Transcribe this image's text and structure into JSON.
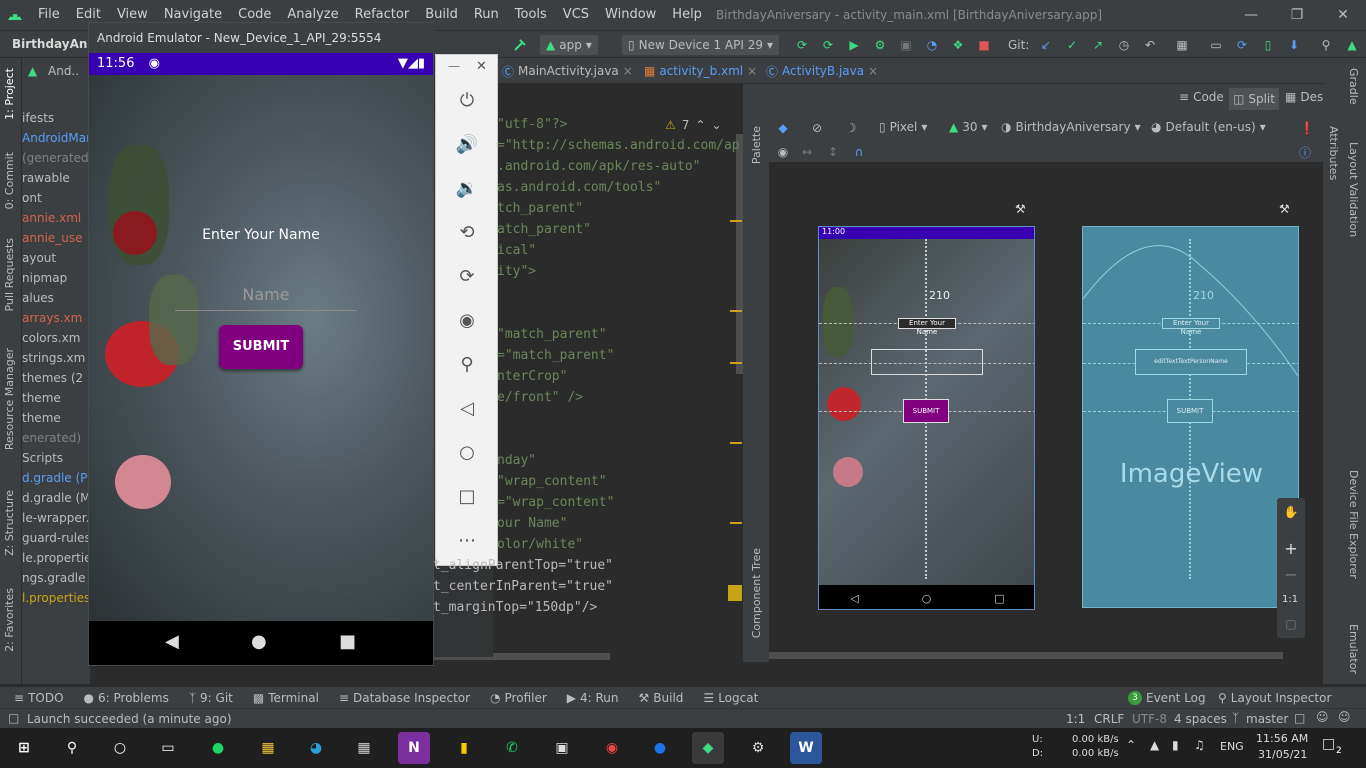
{
  "menubar": {
    "items": [
      "File",
      "Edit",
      "View",
      "Navigate",
      "Code",
      "Analyze",
      "Refactor",
      "Build",
      "Run",
      "Tools",
      "VCS",
      "Window",
      "Help"
    ],
    "window_title": "BirthdayAniversary - activity_main.xml [BirthdayAniversary.app]"
  },
  "toolbar": {
    "project": "BirthdayAnive",
    "run_config": "app",
    "device": "New Device 1 API 29",
    "git_label": "Git:"
  },
  "left_tools": [
    "1: Project",
    "0: Commit",
    "Pull Requests",
    "Resource Manager",
    "Z: Structure",
    "2: Favorites"
  ],
  "project_tree": {
    "header": "And..",
    "items": [
      {
        "text": "ifests",
        "color": "#bbbbbb"
      },
      {
        "text": "AndroidMani",
        "color": "#589df6"
      },
      {
        "text": "(generated)",
        "color": "#808080"
      },
      {
        "text": "rawable",
        "color": "#bbbbbb"
      },
      {
        "text": "ont",
        "color": "#bbbbbb"
      },
      {
        "text": "annie.xml",
        "color": "#d0634f"
      },
      {
        "text": "annie_use",
        "color": "#d0634f"
      },
      {
        "text": "ayout",
        "color": "#bbbbbb"
      },
      {
        "text": "nipmap",
        "color": "#bbbbbb"
      },
      {
        "text": "alues",
        "color": "#bbbbbb"
      },
      {
        "text": "arrays.xm",
        "color": "#d0634f"
      },
      {
        "text": "colors.xm",
        "color": "#bbbbbb"
      },
      {
        "text": "strings.xm",
        "color": "#bbbbbb"
      },
      {
        "text": "themes (2",
        "color": "#bbbbbb"
      },
      {
        "text": "theme",
        "color": "#bbbbbb"
      },
      {
        "text": "theme",
        "color": "#bbbbbb"
      },
      {
        "text": "enerated)",
        "color": "#808080"
      },
      {
        "text": "Scripts",
        "color": "#bbbbbb"
      },
      {
        "text": "d.gradle (Pro",
        "color": "#589df6"
      },
      {
        "text": "d.gradle (Mo",
        "color": "#bbbbbb"
      },
      {
        "text": "le-wrapper.p",
        "color": "#bbbbbb"
      },
      {
        "text": "guard-rules.p",
        "color": "#bbbbbb"
      },
      {
        "text": "le.properties",
        "color": "#bbbbbb"
      },
      {
        "text": "ngs.gradle (P",
        "color": "#bbbbbb"
      },
      {
        "text": "l.properties (",
        "color": "#c8a415"
      }
    ]
  },
  "editor_tabs": [
    {
      "label": "MainActivity.java",
      "color": "#bbbbbb"
    },
    {
      "label": "activity_b.xml",
      "color": "#589df6"
    },
    {
      "label": "ActivityB.java",
      "color": "#589df6"
    }
  ],
  "editor": {
    "warnings": "7",
    "lines": [
      {
        "text": "\"utf-8\"?>",
        "color": "#6a8759"
      },
      {
        "text": "=\"http://schemas.android.com/ap",
        "color": "#6a8759"
      },
      {
        "text": ".android.com/apk/res-auto\"",
        "color": "#6a8759"
      },
      {
        "text": "as.android.com/tools\"",
        "color": "#6a8759"
      },
      {
        "text": "tch_parent\"",
        "color": "#6a8759"
      },
      {
        "text": "atch_parent\"",
        "color": "#6a8759"
      },
      {
        "text": "ical\"",
        "color": "#6a8759"
      },
      {
        "text": "ity\">",
        "color": "#6a8759"
      },
      {
        "text": "",
        "color": "#6a8759"
      },
      {
        "text": "",
        "color": "#6a8759"
      },
      {
        "text": "\"match_parent\"",
        "color": "#6a8759"
      },
      {
        "text": "=\"match_parent\"",
        "color": "#6a8759"
      },
      {
        "text": "nterCrop\"",
        "color": "#6a8759"
      },
      {
        "text": "e/front\" />",
        "color": "#6a8759"
      },
      {
        "text": "",
        "color": "#6a8759"
      },
      {
        "text": "",
        "color": "#6a8759"
      },
      {
        "text": "nday\"",
        "color": "#6a8759"
      },
      {
        "text": "\"wrap_content\"",
        "color": "#6a8759"
      },
      {
        "text": "=\"wrap_content\"",
        "color": "#6a8759"
      },
      {
        "text": "our Name\"",
        "color": "#6a8759"
      },
      {
        "text": "olor/white\"",
        "color": "#6a8759"
      },
      {
        "text": "t_alignParentTop=\"true\"",
        "color": "#bababa"
      },
      {
        "text": "t_centerInParent=\"true\"",
        "color": "#bababa"
      },
      {
        "text": "t_marginTop=\"150dp\"/>",
        "color": "#bababa"
      }
    ]
  },
  "emulator": {
    "title": "Android Emulator - New_Device_1_API_29:5554",
    "time": "11:56",
    "label": "Enter Your Name",
    "name_hint": "Name",
    "button": "SUBMIT"
  },
  "design": {
    "view_modes": [
      "Code",
      "Split",
      "Design"
    ],
    "device": "Pixel",
    "api": "30",
    "theme": "BirthdayAniversary",
    "locale": "Default (en-us)",
    "preview_time": "11:00",
    "preview_label": "Enter Your Name",
    "preview_button": "SUBMIT",
    "constraint_value": "210",
    "blueprint_text_hint": "editTextTextPersonName",
    "blueprint_imageview": "ImageView",
    "zoom_ratio": "1:1",
    "palette": "Palette",
    "component_tree": "Component Tree"
  },
  "right_tools": [
    "Gradle",
    "Attributes",
    "Layout Validation",
    "Device File Explorer",
    "Emulator"
  ],
  "bottom_tabs": [
    {
      "label": "TODO"
    },
    {
      "label": "6: Problems"
    },
    {
      "label": "9: Git"
    },
    {
      "label": "Terminal"
    },
    {
      "label": "Database Inspector"
    },
    {
      "label": "Profiler"
    },
    {
      "label": "4: Run"
    },
    {
      "label": "Build"
    },
    {
      "label": "Logcat"
    }
  ],
  "bottom_right_tabs": [
    {
      "label": "Event Log",
      "badge": "3"
    },
    {
      "label": "Layout Inspector"
    }
  ],
  "status": {
    "message": "Launch succeeded (a minute ago)",
    "position": "1:1",
    "line_sep": "CRLF",
    "encoding": "UTF-8",
    "indent": "4 spaces",
    "branch": "master"
  },
  "taskbar": {
    "net_up_label": "U:",
    "net_down_label": "D:",
    "net_up": "0.00 kB/s",
    "net_down": "0.00 kB/s",
    "lang": "ENG",
    "time": "11:56 AM",
    "date": "31/05/21",
    "notifications": "2"
  },
  "colors": {
    "accent_purple": "#800080",
    "status_purple": "#3700b3",
    "android_green": "#3ddc84",
    "link_blue": "#589df6"
  }
}
